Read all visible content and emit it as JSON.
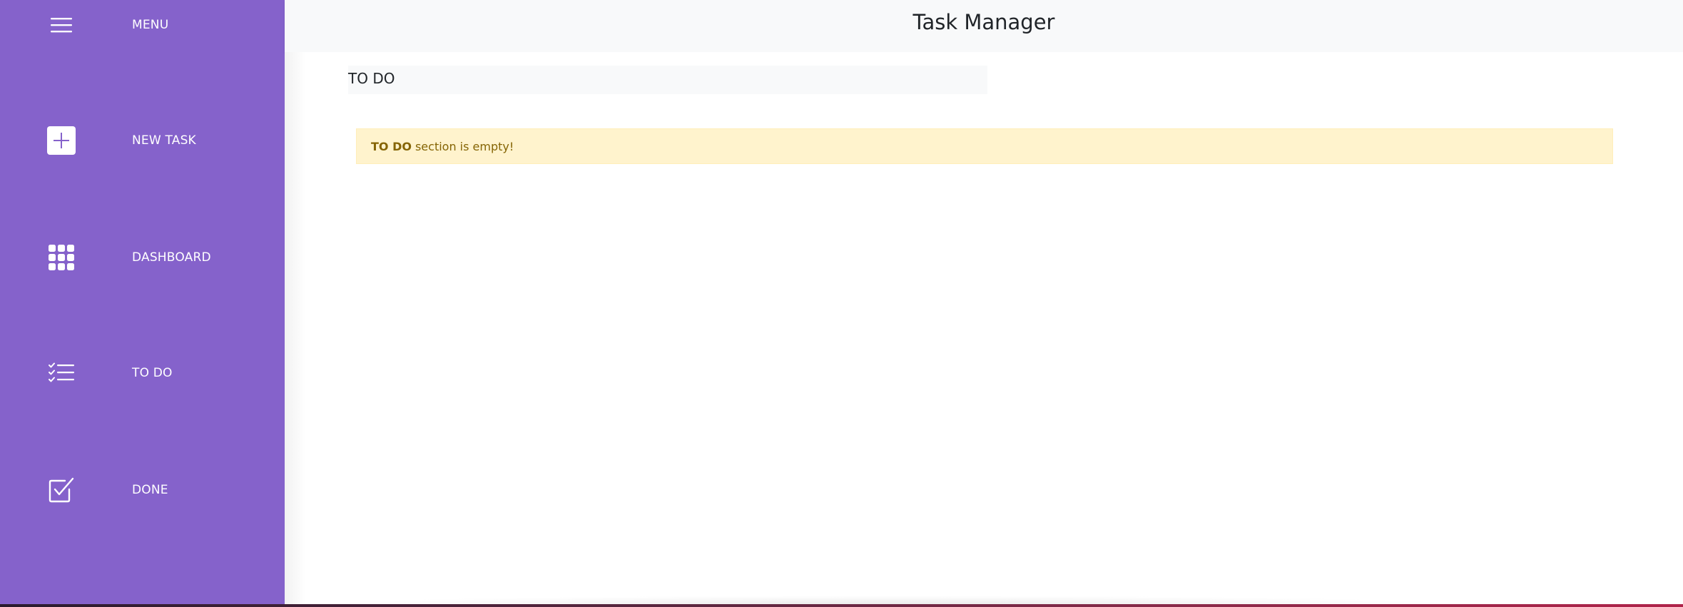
{
  "sidebar": {
    "menu_label": "MENU",
    "items": [
      {
        "label": "NEW TASK",
        "icon": "plus-square-icon"
      },
      {
        "label": "DASHBOARD",
        "icon": "grid-icon"
      },
      {
        "label": "TO DO",
        "icon": "checklist-icon"
      },
      {
        "label": "DONE",
        "icon": "check-square-icon"
      }
    ],
    "color": "#8562cb"
  },
  "header": {
    "title": "Task Manager"
  },
  "main": {
    "section_title": "TO DO",
    "alert": {
      "strong": "TO DO",
      "text": "section is empty!",
      "background": "#fff3cd",
      "color": "#856404"
    }
  }
}
